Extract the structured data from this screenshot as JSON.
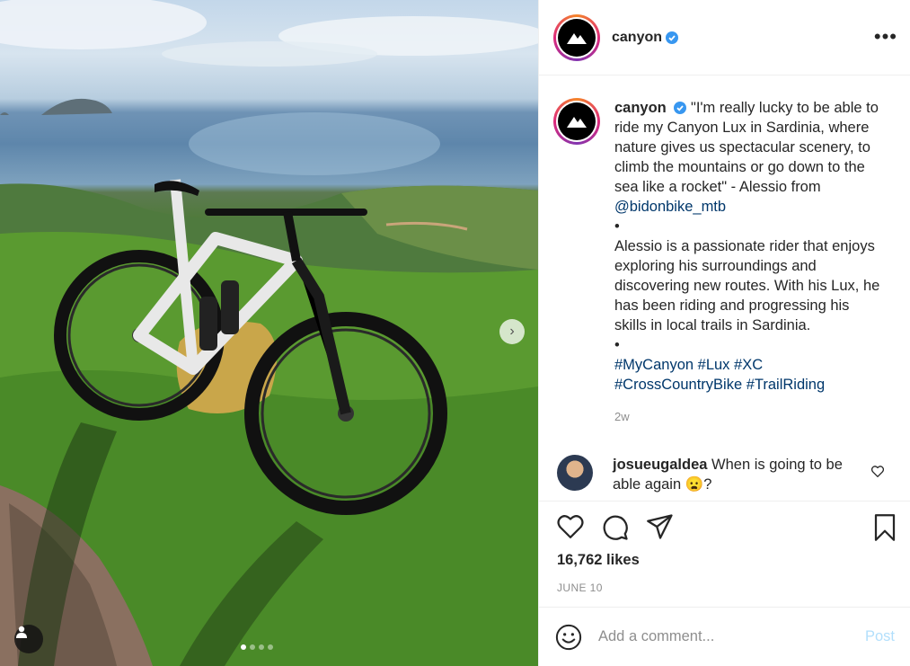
{
  "post": {
    "username": "canyon",
    "verified": true,
    "caption_quote": "\"I'm really lucky to be able to ride my Canyon Lux in Sardinia, where nature gives us spectacular scenery, to climb the mountains or go down to the sea like a rocket\" - Alessio from ",
    "caption_mention": "@bidonbike_mtb",
    "caption_bullet_1": "•",
    "caption_body": "Alessio is a passionate rider that enjoys exploring his surroundings and discovering new routes. With his Lux, he has been riding and progressing his skills in local trails in Sardinia.",
    "caption_bullet_2": "•",
    "hashtags": [
      "#MyCanyon",
      "#Lux",
      "#XC",
      "#CrossCountryBike",
      "#TrailRiding"
    ],
    "age": "2w",
    "likes": "16,762 likes",
    "date": "JUNE 10"
  },
  "comment": {
    "username": "josueugaldea",
    "text": "When is going to be able again 😦?"
  },
  "composer": {
    "placeholder": "Add a comment...",
    "post_label": "Post"
  },
  "header": {
    "more_label": "•••"
  },
  "photo": {
    "next_label": "›",
    "slide_count": 4,
    "active_slide": 1
  },
  "colors": {
    "link": "#00376b",
    "verified": "#3897f0",
    "muted": "#8e8e8e",
    "post_disabled": "#b2dffc"
  },
  "icons": {
    "verified": "verified-badge-icon",
    "more": "more-options-icon",
    "like": "heart-icon",
    "comment": "comment-bubble-icon",
    "share": "paper-plane-icon",
    "save": "bookmark-icon",
    "emoji": "smiley-icon",
    "tag_user": "user-tag-icon",
    "next": "chevron-right-icon"
  }
}
